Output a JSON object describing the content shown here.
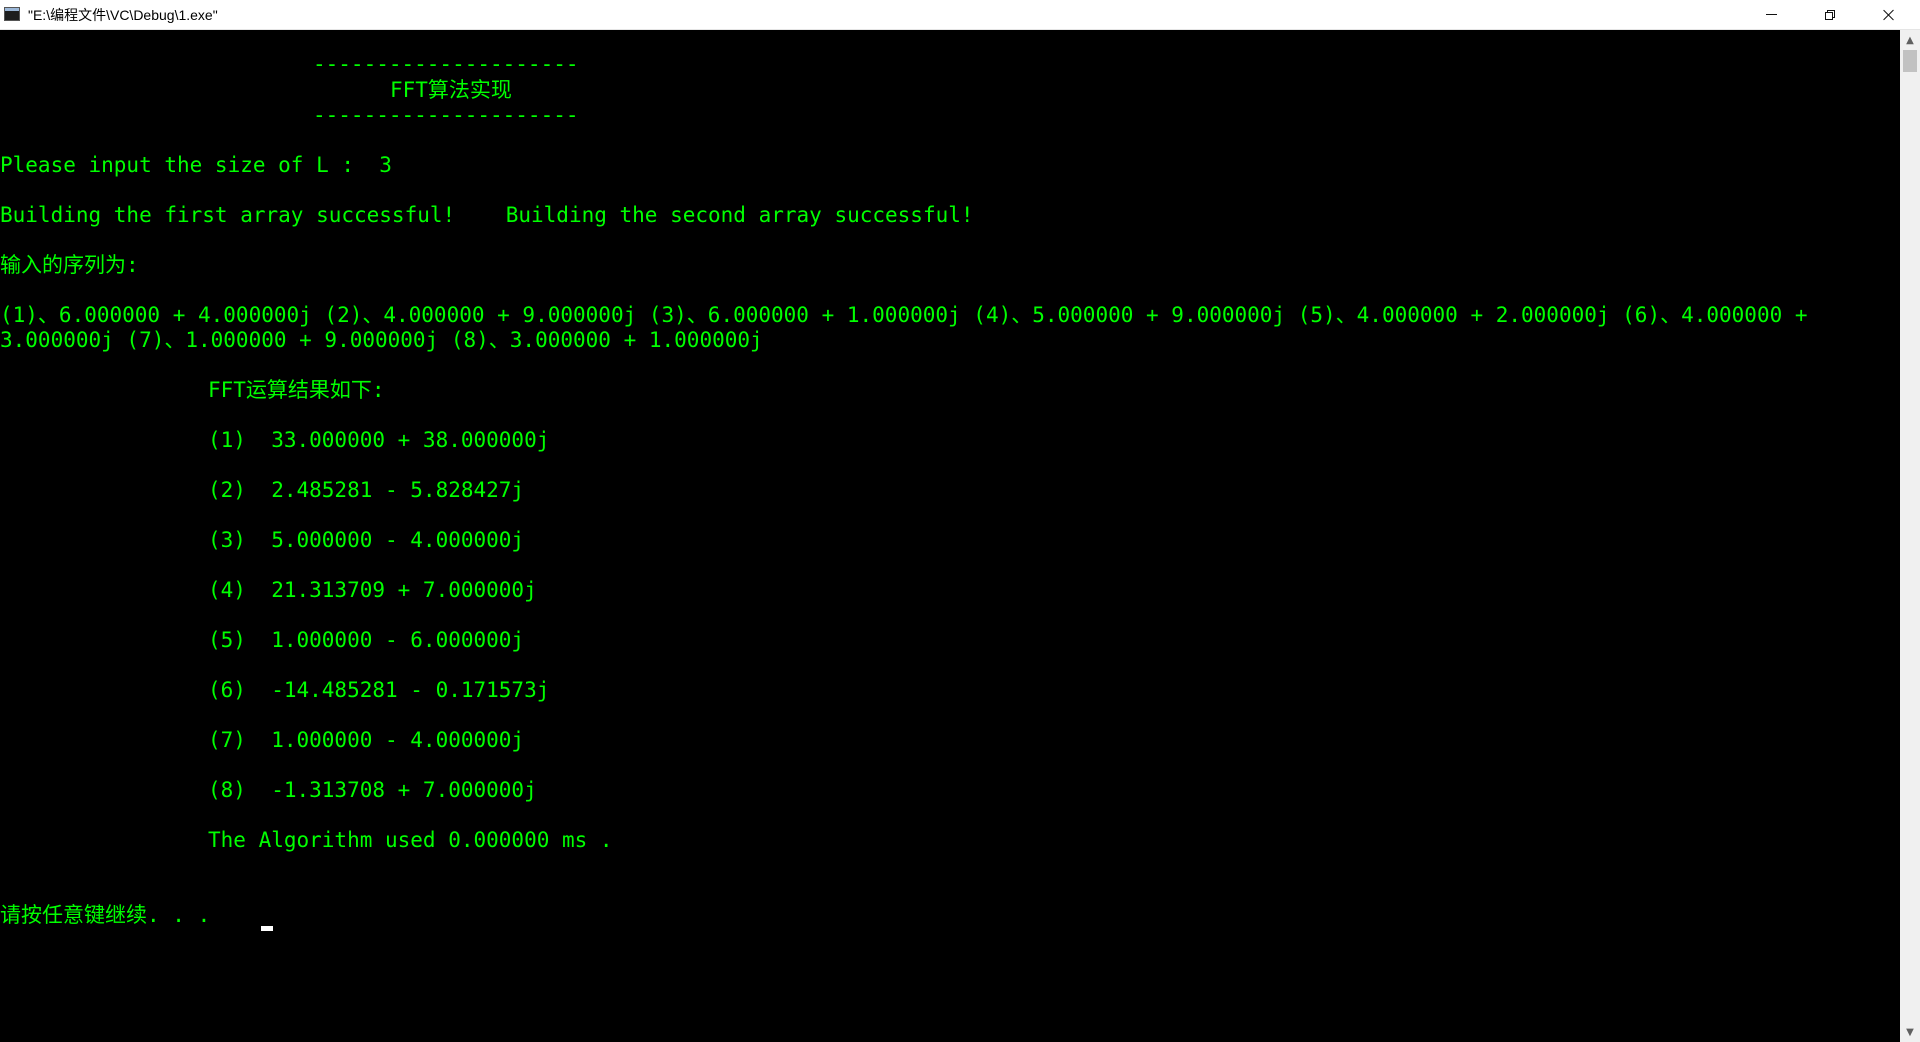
{
  "window": {
    "title": "\"E:\\编程文件\\VC\\Debug\\1.exe\""
  },
  "console": {
    "dash_top": "---------------------",
    "heading": "FFT算法实现",
    "dash_bottom": "---------------------",
    "prompt": "Please input the size of L :  3",
    "build_msg": "Building the first array successful!    Building the second array successful!",
    "input_label": "输入的序列为:",
    "input_line1": "(1)、6.000000 + 4.000000j (2)、4.000000 + 9.000000j (3)、6.000000 + 1.000000j (4)、5.000000 + 9.000000j (5)、4.000000 + 2.000000j (6)、4.000000 +",
    "input_line2": "3.000000j (7)、1.000000 + 9.000000j (8)、3.000000 + 1.000000j",
    "result_label": "FFT运算结果如下:",
    "results": [
      "(1)  33.000000 + 38.000000j",
      "(2)  2.485281 - 5.828427j",
      "(3)  5.000000 - 4.000000j",
      "(4)  21.313709 + 7.000000j",
      "(5)  1.000000 - 6.000000j",
      "(6)  -14.485281 - 0.171573j",
      "(7)  1.000000 - 4.000000j",
      "(8)  -1.313708 + 7.000000j"
    ],
    "timing": "The Algorithm used 0.000000 ms .",
    "continue_prompt": "请按任意键继续. . ."
  },
  "colors": {
    "console_text": "#00ff00",
    "console_bg": "#000000",
    "titlebar_bg": "#ffffff"
  },
  "icons": {
    "app": "console-app-icon",
    "minimize": "minimize-icon",
    "maximize": "restore-icon",
    "close": "close-icon"
  }
}
